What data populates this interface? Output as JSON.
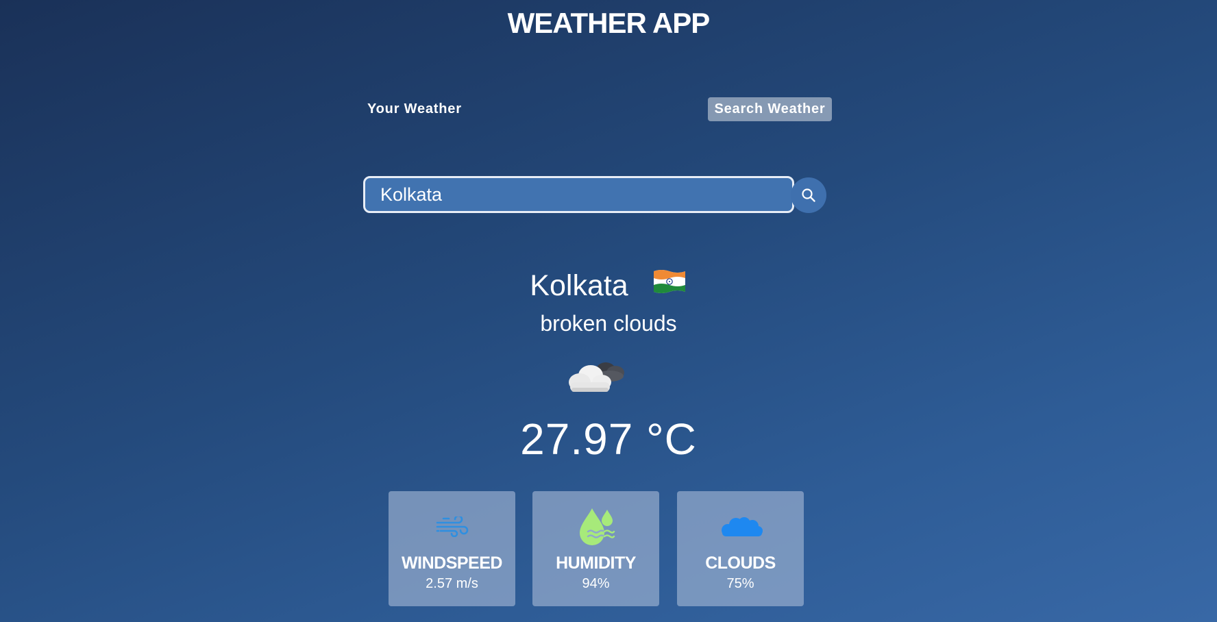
{
  "app": {
    "title": "WEATHER APP"
  },
  "tabs": {
    "your_weather": "Your Weather",
    "search_weather": "Search Weather",
    "active": "search_weather"
  },
  "search": {
    "value": "Kolkata",
    "icon": "search-icon"
  },
  "weather": {
    "city": "Kolkata",
    "country_flag": "india-flag-icon",
    "description": "broken clouds",
    "condition_icon": "broken-clouds-icon",
    "temperature": "27.97 °C"
  },
  "stats": [
    {
      "title": "WINDSPEED",
      "value": "2.57 m/s",
      "icon": "wind-icon"
    },
    {
      "title": "HUMIDITY",
      "value": "94%",
      "icon": "humidity-icon"
    },
    {
      "title": "CLOUDS",
      "value": "75%",
      "icon": "clouds-icon"
    }
  ],
  "colors": {
    "background_start": "#1a3158",
    "background_end": "#3868a6",
    "input_bg": "#4173b0",
    "wind_icon": "#2f8fe0",
    "humidity_icon": "#a7ea7a",
    "clouds_icon": "#1e88f0"
  }
}
